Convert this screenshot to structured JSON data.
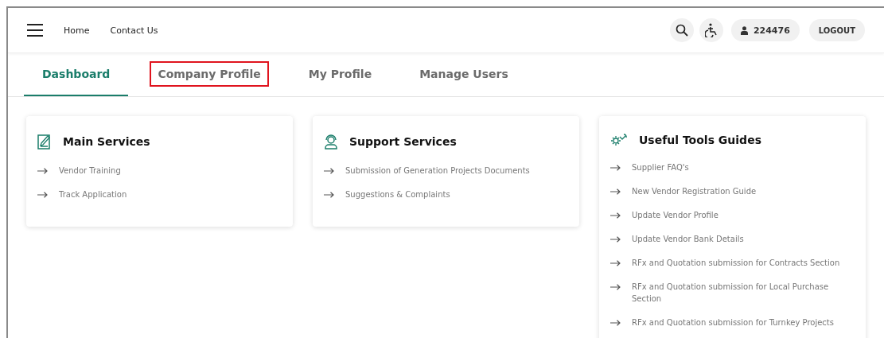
{
  "header": {
    "nav_links": [
      "Home",
      "Contact Us"
    ],
    "user_id": "224476",
    "logout": "LOGOUT"
  },
  "tabs": [
    {
      "label": "Dashboard",
      "selected": true,
      "highlighted": false
    },
    {
      "label": "Company Profile",
      "selected": false,
      "highlighted": true
    },
    {
      "label": "My Profile",
      "selected": false,
      "highlighted": false
    },
    {
      "label": "Manage Users",
      "selected": false,
      "highlighted": false
    }
  ],
  "cards": [
    {
      "kind": "edit",
      "title": "Main Services",
      "links": [
        "Vendor Training",
        "Track Application"
      ]
    },
    {
      "kind": "support",
      "title": "Support Services",
      "links": [
        "Submission of Generation Projects Documents",
        "Suggestions & Complaints"
      ]
    },
    {
      "kind": "tools",
      "title": "Useful Tools Guides",
      "links": [
        "Supplier FAQ's",
        "New Vendor Registration Guide",
        "Update Vendor Profile",
        "Update Vendor Bank Details",
        "RFx and Quotation submission for Contracts Section",
        "RFx and Quotation submission for Local Purchase Section",
        "RFx and Quotation submission for Turnkey Projects"
      ]
    }
  ]
}
